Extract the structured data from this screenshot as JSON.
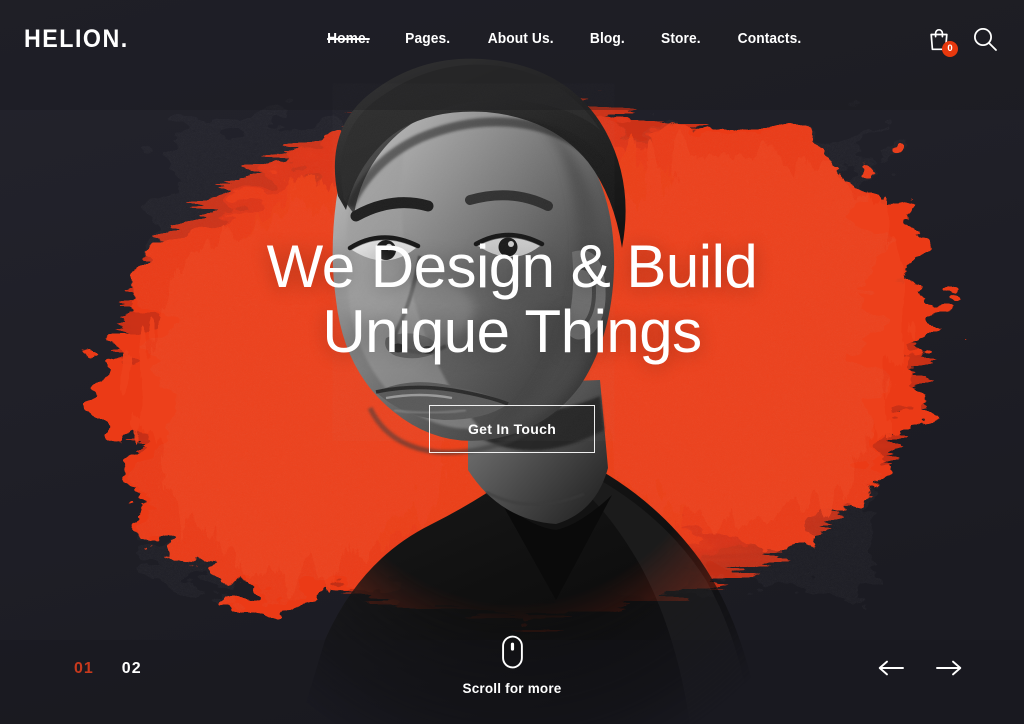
{
  "site": {
    "logo": "HELION.",
    "theme": {
      "background": "#1f1f27",
      "accent_red": "#e8380d",
      "splash_red": "#ef3b17",
      "active_slide": "#c8391d",
      "text": "#ffffff"
    }
  },
  "nav": {
    "items": [
      {
        "label": "Home.",
        "active": true
      },
      {
        "label": "Pages.",
        "active": false
      },
      {
        "label": "About Us.",
        "active": false
      },
      {
        "label": "Blog.",
        "active": false
      },
      {
        "label": "Store.",
        "active": false
      },
      {
        "label": "Contacts.",
        "active": false
      }
    ]
  },
  "header_actions": {
    "cart": {
      "icon": "shopping-bag-icon",
      "badge_count": "0"
    },
    "search": {
      "icon": "search-icon"
    }
  },
  "hero": {
    "headline_line1": "We Design & Build",
    "headline_line2": "Unique Things",
    "cta_label": "Get In Touch"
  },
  "scroll_hint": {
    "icon": "mouse-icon",
    "label": "Scroll for more"
  },
  "slider": {
    "slides": [
      {
        "number": "01",
        "active": true
      },
      {
        "number": "02",
        "active": false
      }
    ],
    "prev_icon": "arrow-left-icon",
    "next_icon": "arrow-right-icon"
  }
}
